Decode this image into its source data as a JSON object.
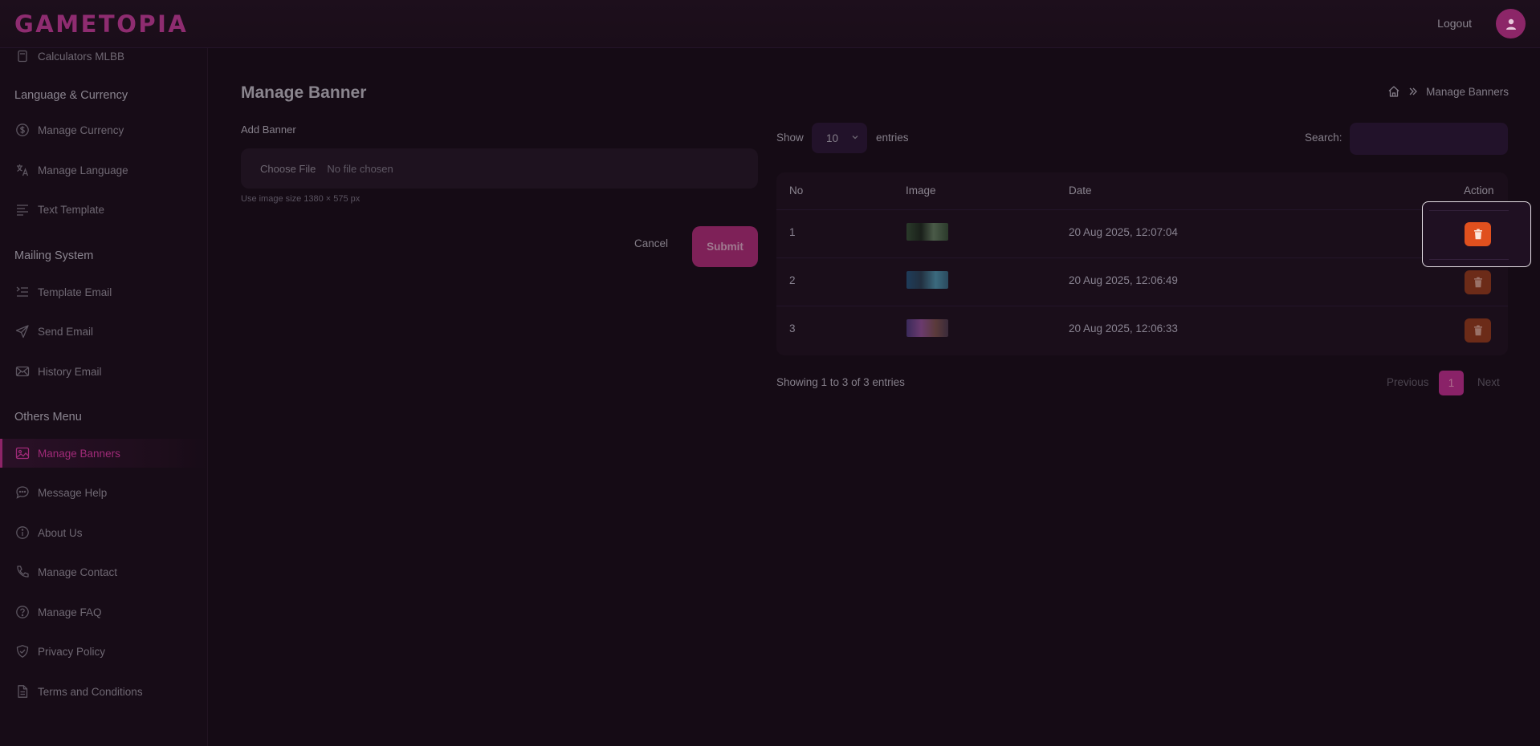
{
  "header": {
    "logo_text": "GAMETOPIA",
    "logout_label": "Logout",
    "avatar_icon": "user-icon"
  },
  "sidebar": {
    "partial_item": {
      "label": "Calculators MLBB",
      "icon": "calculator-icon"
    },
    "sections": [
      {
        "title": "Language & Currency",
        "items": [
          {
            "label": "Manage Currency",
            "icon": "dollar-circle-icon"
          },
          {
            "label": "Manage Language",
            "icon": "translate-icon"
          },
          {
            "label": "Text Template",
            "icon": "text-lines-icon"
          }
        ]
      },
      {
        "title": "Mailing System",
        "items": [
          {
            "label": "Template Email",
            "icon": "list-indent-icon"
          },
          {
            "label": "Send Email",
            "icon": "paper-plane-icon"
          },
          {
            "label": "History Email",
            "icon": "envelope-icon"
          }
        ]
      },
      {
        "title": "Others Menu",
        "items": [
          {
            "label": "Manage Banners",
            "icon": "image-icon",
            "active": true
          },
          {
            "label": "Message Help",
            "icon": "chat-bubble-icon"
          },
          {
            "label": "About Us",
            "icon": "info-circle-icon"
          },
          {
            "label": "Manage Contact",
            "icon": "phone-icon"
          },
          {
            "label": "Manage FAQ",
            "icon": "question-circle-icon"
          },
          {
            "label": "Privacy Policy",
            "icon": "shield-check-icon"
          },
          {
            "label": "Terms and Conditions",
            "icon": "document-icon"
          }
        ]
      }
    ]
  },
  "page": {
    "title": "Manage Banner",
    "breadcrumb": {
      "home_icon": "home-icon",
      "separator_icon": "double-chevron-right-icon",
      "current": "Manage Banners"
    }
  },
  "form": {
    "add_label": "Add Banner",
    "choose_file_label": "Choose File",
    "no_file_text": "No file chosen",
    "hint": "Use image size 1380 × 575 px",
    "cancel_label": "Cancel",
    "submit_label": "Submit"
  },
  "table": {
    "show_label": "Show",
    "entries_value": "10",
    "entries_label": "entries",
    "search_label": "Search:",
    "search_value": "",
    "columns": [
      "No",
      "Image",
      "Date",
      "Action"
    ],
    "rows": [
      {
        "no": "1",
        "date": "20 Aug 2025, 12:07:04",
        "thumb_colors": [
          "#2a3a2a",
          "#4a5a48",
          "#1a201a"
        ]
      },
      {
        "no": "2",
        "date": "20 Aug 2025, 12:06:49",
        "thumb_colors": [
          "#1e3c5a",
          "#3b6a7e",
          "#223040"
        ]
      },
      {
        "no": "3",
        "date": "20 Aug 2025, 12:06:33",
        "thumb_colors": [
          "#3a2a5a",
          "#6a3a6e",
          "#5a3a3a"
        ]
      }
    ],
    "delete_icon": "trash-icon",
    "showing_text": "Showing 1 to 3 of 3 entries",
    "pager": {
      "previous": "Previous",
      "current": "1",
      "next": "Next"
    }
  },
  "colors": {
    "brand": "#8e2468",
    "delete_active": "#e0501e",
    "delete_dim": "#6c2b18"
  }
}
